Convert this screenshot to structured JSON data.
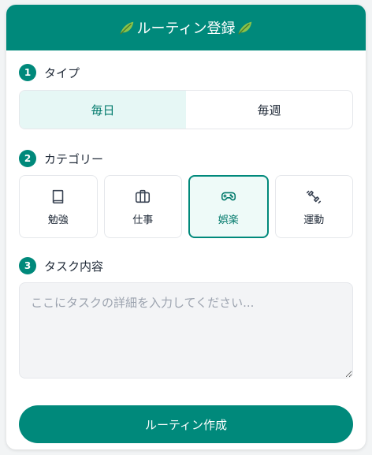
{
  "header": {
    "title": "ルーティン登録",
    "left_icon": "leaf-icon",
    "right_icon": "leaf-icon",
    "background": "#00897b"
  },
  "type_section": {
    "number": "1",
    "label": "タイプ",
    "options": [
      {
        "label": "毎日",
        "selected": true
      },
      {
        "label": "毎週",
        "selected": false
      }
    ]
  },
  "category_section": {
    "number": "2",
    "label": "カテゴリー",
    "options": [
      {
        "label": "勉強",
        "icon": "book-icon",
        "selected": false
      },
      {
        "label": "仕事",
        "icon": "briefcase-icon",
        "selected": false
      },
      {
        "label": "娯楽",
        "icon": "gamepad-icon",
        "selected": true
      },
      {
        "label": "運動",
        "icon": "dumbbell-icon",
        "selected": false
      }
    ]
  },
  "task_section": {
    "number": "3",
    "label": "タスク内容",
    "placeholder": "ここにタスクの詳細を入力してください...",
    "value": ""
  },
  "submit": {
    "label": "ルーティン作成"
  },
  "colors": {
    "accent": "#00897b",
    "accent_light": "#e6f7f5",
    "border": "#e5e7eb",
    "input_bg": "#f3f4f6"
  }
}
